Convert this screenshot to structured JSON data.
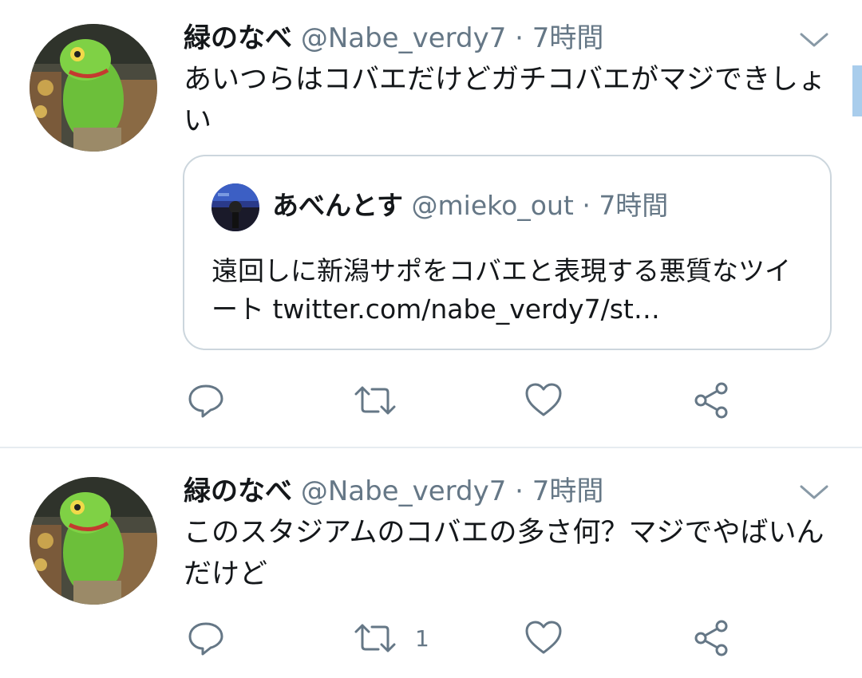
{
  "tweets": [
    {
      "name": "緑のなべ",
      "handle": "@Nabe_verdy7",
      "separator": "·",
      "time": "7時間",
      "text": "あいつらはコバエだけどガチコバエがマジできしょい",
      "quote": {
        "name": "あべんとす",
        "handle": "@mieko_out",
        "separator": "·",
        "time": "7時間",
        "text": "遠回しに新潟サポをコバエと表現する悪質なツイート twitter.com/nabe_verdy7/st…"
      },
      "retweet_count": ""
    },
    {
      "name": "緑のなべ",
      "handle": "@Nabe_verdy7",
      "separator": "·",
      "time": "7時間",
      "text": "このスタジアムのコバエの多さ何？マジでやばいんだけど",
      "retweet_count": "1"
    }
  ],
  "icons": {
    "reply": "reply-icon",
    "retweet": "retweet-icon",
    "like": "like-icon",
    "share": "share-icon",
    "more": "chevron-down-icon"
  },
  "colors": {
    "text": "#14171a",
    "secondary": "#657786",
    "border": "#ccd6dd",
    "divider": "#e6ecf0"
  }
}
